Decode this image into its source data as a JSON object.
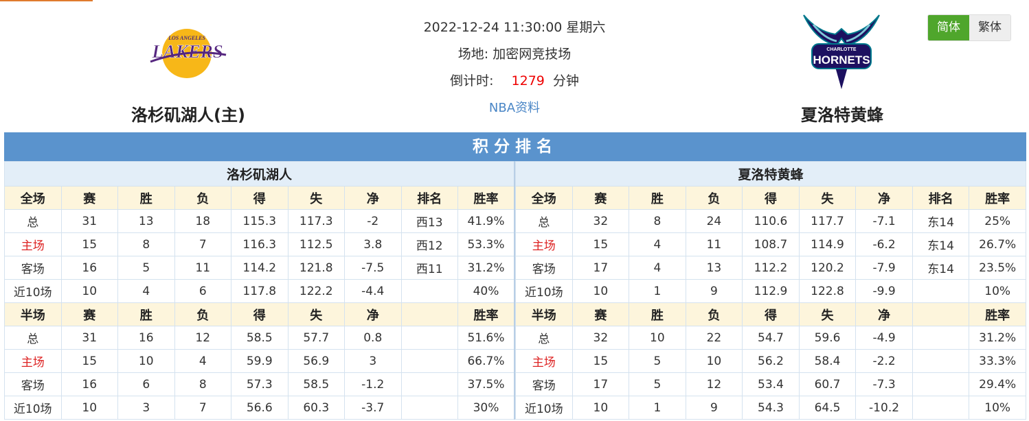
{
  "match": {
    "datetime": "2022-12-24 11:30:00 星期六",
    "venue_label": "场地:",
    "venue": "加密网竞技场",
    "countdown_label": "倒计时:",
    "countdown_value": "1279",
    "countdown_unit": "分钟",
    "nba_link": "NBA资料"
  },
  "home_team": {
    "name": "洛杉矶湖人(主)",
    "logo": "LAKERS",
    "logo_sub": "LOS ANGELES",
    "table_name": "洛杉矶湖人"
  },
  "away_team": {
    "name": "夏洛特黄蜂",
    "logo": "HORNETS",
    "logo_sub": "CHARLOTTE",
    "table_name": "夏洛特黄蜂"
  },
  "lang": {
    "simplified": "简体",
    "traditional": "繁体"
  },
  "ranking": {
    "title": "积分排名",
    "full_headers": [
      "全场",
      "赛",
      "胜",
      "负",
      "得",
      "失",
      "净",
      "排名",
      "胜率"
    ],
    "half_headers": [
      "半场",
      "赛",
      "胜",
      "负",
      "得",
      "失",
      "净",
      "",
      "胜率"
    ],
    "home_full": [
      [
        "总",
        "31",
        "13",
        "18",
        "115.3",
        "117.3",
        "-2",
        "西13",
        "41.9%"
      ],
      [
        "主场",
        "15",
        "8",
        "7",
        "116.3",
        "112.5",
        "3.8",
        "西12",
        "53.3%"
      ],
      [
        "客场",
        "16",
        "5",
        "11",
        "114.2",
        "121.8",
        "-7.5",
        "西11",
        "31.2%"
      ],
      [
        "近10场",
        "10",
        "4",
        "6",
        "117.8",
        "122.2",
        "-4.4",
        "",
        "40%"
      ]
    ],
    "home_half": [
      [
        "总",
        "31",
        "16",
        "12",
        "58.5",
        "57.7",
        "0.8",
        "",
        "51.6%"
      ],
      [
        "主场",
        "15",
        "10",
        "4",
        "59.9",
        "56.9",
        "3",
        "",
        "66.7%"
      ],
      [
        "客场",
        "16",
        "6",
        "8",
        "57.3",
        "58.5",
        "-1.2",
        "",
        "37.5%"
      ],
      [
        "近10场",
        "10",
        "3",
        "7",
        "56.6",
        "60.3",
        "-3.7",
        "",
        "30%"
      ]
    ],
    "away_full": [
      [
        "总",
        "32",
        "8",
        "24",
        "110.6",
        "117.7",
        "-7.1",
        "东14",
        "25%"
      ],
      [
        "主场",
        "15",
        "4",
        "11",
        "108.7",
        "114.9",
        "-6.2",
        "东14",
        "26.7%"
      ],
      [
        "客场",
        "17",
        "4",
        "13",
        "112.2",
        "120.2",
        "-7.9",
        "东14",
        "23.5%"
      ],
      [
        "近10场",
        "10",
        "1",
        "9",
        "112.9",
        "122.8",
        "-9.9",
        "",
        "10%"
      ]
    ],
    "away_half": [
      [
        "总",
        "32",
        "10",
        "22",
        "54.7",
        "59.6",
        "-4.9",
        "",
        "31.2%"
      ],
      [
        "主场",
        "15",
        "5",
        "10",
        "56.2",
        "58.4",
        "-2.2",
        "",
        "33.3%"
      ],
      [
        "客场",
        "17",
        "5",
        "12",
        "53.4",
        "60.7",
        "-7.3",
        "",
        "29.4%"
      ],
      [
        "近10场",
        "10",
        "1",
        "9",
        "54.3",
        "64.5",
        "-10.2",
        "",
        "10%"
      ]
    ]
  },
  "colors": {
    "title_bar": "#5a93cd",
    "team_header_bg": "#e3eef8",
    "column_header_bg": "#fdf5dc",
    "home_label": "#dd2222",
    "countdown": "#ee0000",
    "lang_active": "#4fa62c"
  }
}
